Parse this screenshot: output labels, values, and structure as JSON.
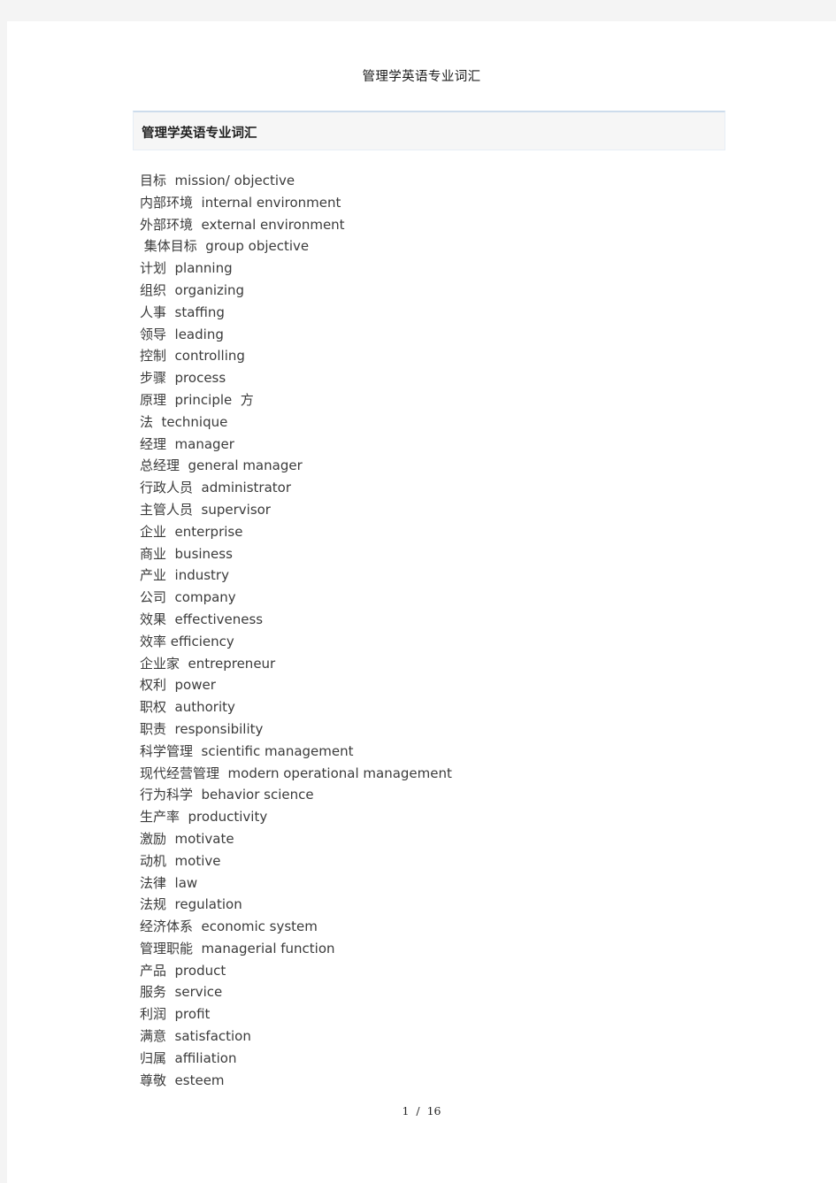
{
  "document": {
    "title": "管理学英语专业词汇",
    "section_header": "管理学英语专业词汇",
    "page_indicator": "1  /  16",
    "page_current": "1",
    "page_total": "16",
    "colors": {
      "page_background": "#ffffff",
      "outer_background": "#f4f4f4",
      "header_band_background": "#f6f6f6",
      "header_band_top_border": "#cddcec",
      "header_band_side_border": "#e7eef6",
      "body_text": "#3b3b3b",
      "title_text": "#1a1a1a"
    }
  },
  "vocabulary": {
    "entries": [
      {
        "zh": "目标",
        "en": "mission/ objective",
        "line": "目标  mission/ objective"
      },
      {
        "zh": "内部环境",
        "en": "internal environment",
        "line": "内部环境  internal environment"
      },
      {
        "zh": "外部环境",
        "en": "external environment",
        "line": "外部环境  external environment"
      },
      {
        "zh": "集体目标",
        "en": "group objective",
        "line": " 集体目标  group objective"
      },
      {
        "zh": "计划",
        "en": "planning",
        "line": "计划  planning"
      },
      {
        "zh": "组织",
        "en": "organizing",
        "line": "组织  organizing"
      },
      {
        "zh": "人事",
        "en": "staffing",
        "line": "人事  staffing"
      },
      {
        "zh": "领导",
        "en": "leading",
        "line": "领导  leading"
      },
      {
        "zh": "控制",
        "en": "controlling",
        "line": "控制  controlling"
      },
      {
        "zh": "步骤",
        "en": "process",
        "line": "步骤  process"
      },
      {
        "zh": "原理",
        "en": "principle",
        "line": "原理  principle  方"
      },
      {
        "zh": "法",
        "en": "technique",
        "line": "法  technique"
      },
      {
        "zh": "经理",
        "en": "manager",
        "line": "经理  manager"
      },
      {
        "zh": "总经理",
        "en": "general manager",
        "line": "总经理  general manager"
      },
      {
        "zh": "行政人员",
        "en": "administrator",
        "line": "行政人员  administrator"
      },
      {
        "zh": "主管人员",
        "en": "supervisor",
        "line": "主管人员  supervisor"
      },
      {
        "zh": "企业",
        "en": "enterprise",
        "line": "企业  enterprise"
      },
      {
        "zh": "商业",
        "en": "business",
        "line": "商业  business"
      },
      {
        "zh": "产业",
        "en": "industry",
        "line": "产业  industry"
      },
      {
        "zh": "公司",
        "en": "company",
        "line": "公司  company"
      },
      {
        "zh": "效果",
        "en": "effectiveness",
        "line": "效果  effectiveness"
      },
      {
        "zh": "效率",
        "en": "efficiency",
        "line": "效率 efficiency"
      },
      {
        "zh": "企业家",
        "en": "entrepreneur",
        "line": "企业家  entrepreneur"
      },
      {
        "zh": "权利",
        "en": "power",
        "line": "权利  power"
      },
      {
        "zh": "职权",
        "en": "authority",
        "line": "职权  authority"
      },
      {
        "zh": "职责",
        "en": "responsibility",
        "line": "职责  responsibility"
      },
      {
        "zh": "科学管理",
        "en": "scientific management",
        "line": "科学管理  scientific management"
      },
      {
        "zh": "现代经营管理",
        "en": "modern operational management",
        "line": "现代经营管理  modern operational management"
      },
      {
        "zh": "行为科学",
        "en": "behavior science",
        "line": "行为科学  behavior science"
      },
      {
        "zh": "生产率",
        "en": "productivity",
        "line": "生产率  productivity"
      },
      {
        "zh": "激励",
        "en": "motivate",
        "line": "激励  motivate"
      },
      {
        "zh": "动机",
        "en": "motive",
        "line": "动机  motive"
      },
      {
        "zh": "法律",
        "en": "law",
        "line": "法律  law"
      },
      {
        "zh": "法规",
        "en": "regulation",
        "line": "法规  regulation"
      },
      {
        "zh": "经济体系",
        "en": "economic system",
        "line": "经济体系  economic system"
      },
      {
        "zh": "管理职能",
        "en": "managerial function",
        "line": "管理职能  managerial function"
      },
      {
        "zh": "产品",
        "en": "product",
        "line": "产品  product"
      },
      {
        "zh": "服务",
        "en": "service",
        "line": "服务  service"
      },
      {
        "zh": "利润",
        "en": "profit",
        "line": "利润  profit"
      },
      {
        "zh": "满意",
        "en": "satisfaction",
        "line": "满意  satisfaction"
      },
      {
        "zh": "归属",
        "en": "affiliation",
        "line": "归属  affiliation"
      },
      {
        "zh": "尊敬",
        "en": "esteem",
        "line": "尊敬  esteem"
      }
    ]
  }
}
